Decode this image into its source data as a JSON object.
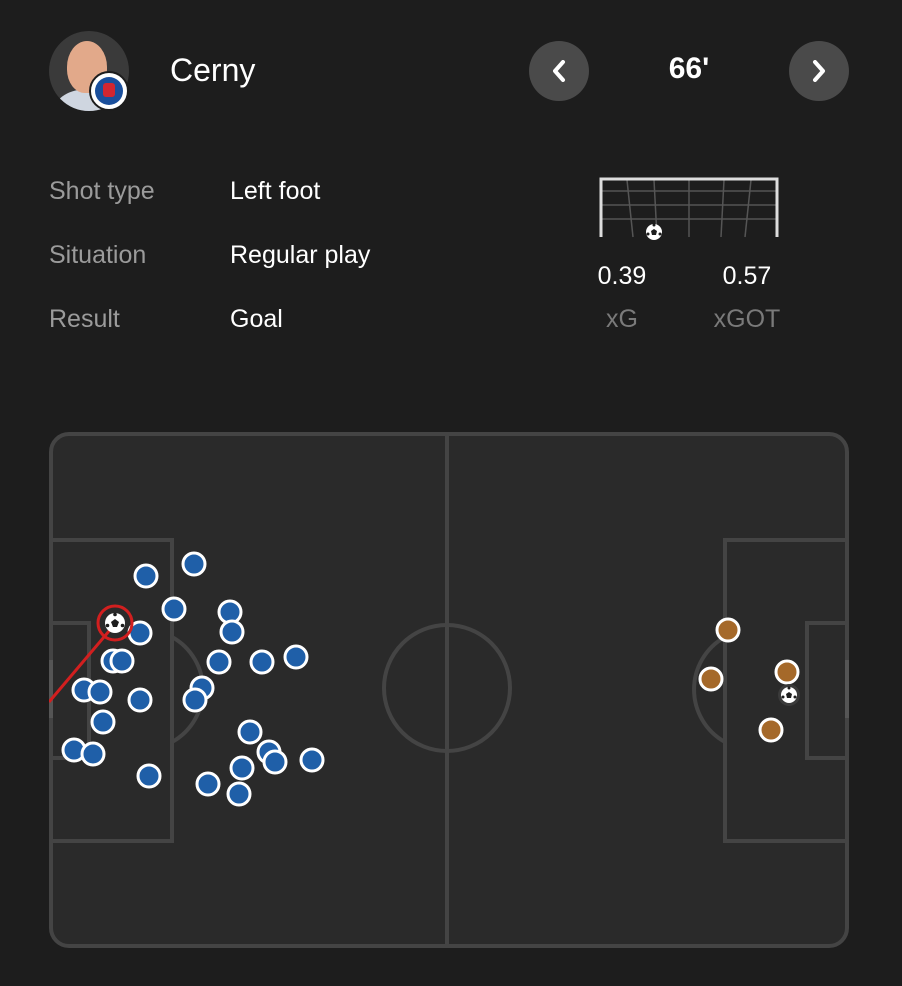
{
  "player": {
    "name": "Cerny"
  },
  "header": {
    "minute": "66'"
  },
  "details": [
    {
      "label": "Shot type",
      "value": "Left foot"
    },
    {
      "label": "Situation",
      "value": "Regular play"
    },
    {
      "label": "Result",
      "value": "Goal"
    }
  ],
  "metrics": {
    "xg": {
      "label": "xG",
      "value": "0.39"
    },
    "xgot": {
      "label": "xGOT",
      "value": "0.57"
    }
  },
  "colors": {
    "background": "#1d1d1d",
    "pitch": "#2a2a2a",
    "pitch_lines": "#444444",
    "team_home": "#1f5fa8",
    "team_away": "#a5692a",
    "shot_line": "#d21f1f",
    "muted_text": "#9b9b9b"
  },
  "icons": {
    "prev": "chevron-left-icon",
    "next": "chevron-right-icon",
    "ball": "football-icon"
  }
}
